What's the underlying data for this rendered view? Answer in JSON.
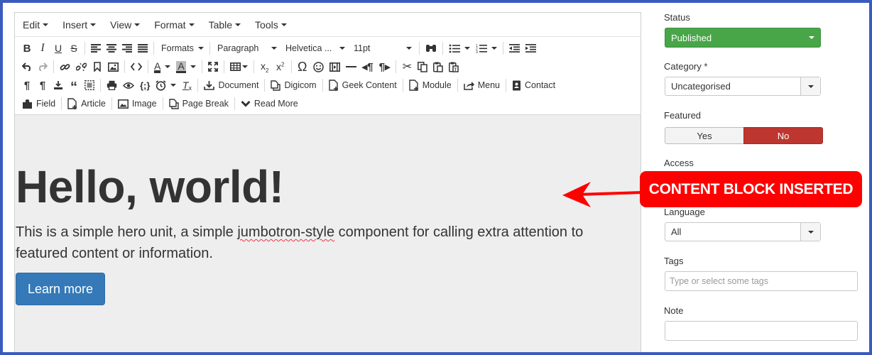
{
  "menubar": [
    "Edit",
    "Insert",
    "View",
    "Format",
    "Table",
    "Tools"
  ],
  "toolbar": {
    "formats": "Formats",
    "paragraph": "Paragraph",
    "font": "Helvetica ...",
    "size": "11pt",
    "document": "Document",
    "digicom": "Digicom",
    "geek_content": "Geek Content",
    "module": "Module",
    "menu": "Menu",
    "contact": "Contact",
    "field": "Field",
    "article": "Article",
    "image": "Image",
    "page_break": "Page Break",
    "read_more": "Read More"
  },
  "content": {
    "heading": "Hello, world!",
    "text_before": "This is a simple hero unit, a simple ",
    "text_misspelled": "jumbotron-style",
    "text_after": " component for calling extra attention to featured content or information.",
    "button": "Learn more"
  },
  "sidebar": {
    "status_label": "Status",
    "status_value": "Published",
    "category_label": "Category *",
    "category_value": "Uncategorised",
    "featured_label": "Featured",
    "featured_yes": "Yes",
    "featured_no": "No",
    "access_label": "Access",
    "language_label": "Language",
    "language_value": "All",
    "tags_label": "Tags",
    "tags_placeholder": "Type or select some tags",
    "note_label": "Note"
  },
  "annotation": {
    "text": "CONTENT BLOCK INSERTED",
    "color": "#ff0000"
  },
  "colors": {
    "published": "#48a648",
    "featured_no": "#bd362f",
    "button": "#3579b8",
    "frame": "#3a5bbd"
  }
}
